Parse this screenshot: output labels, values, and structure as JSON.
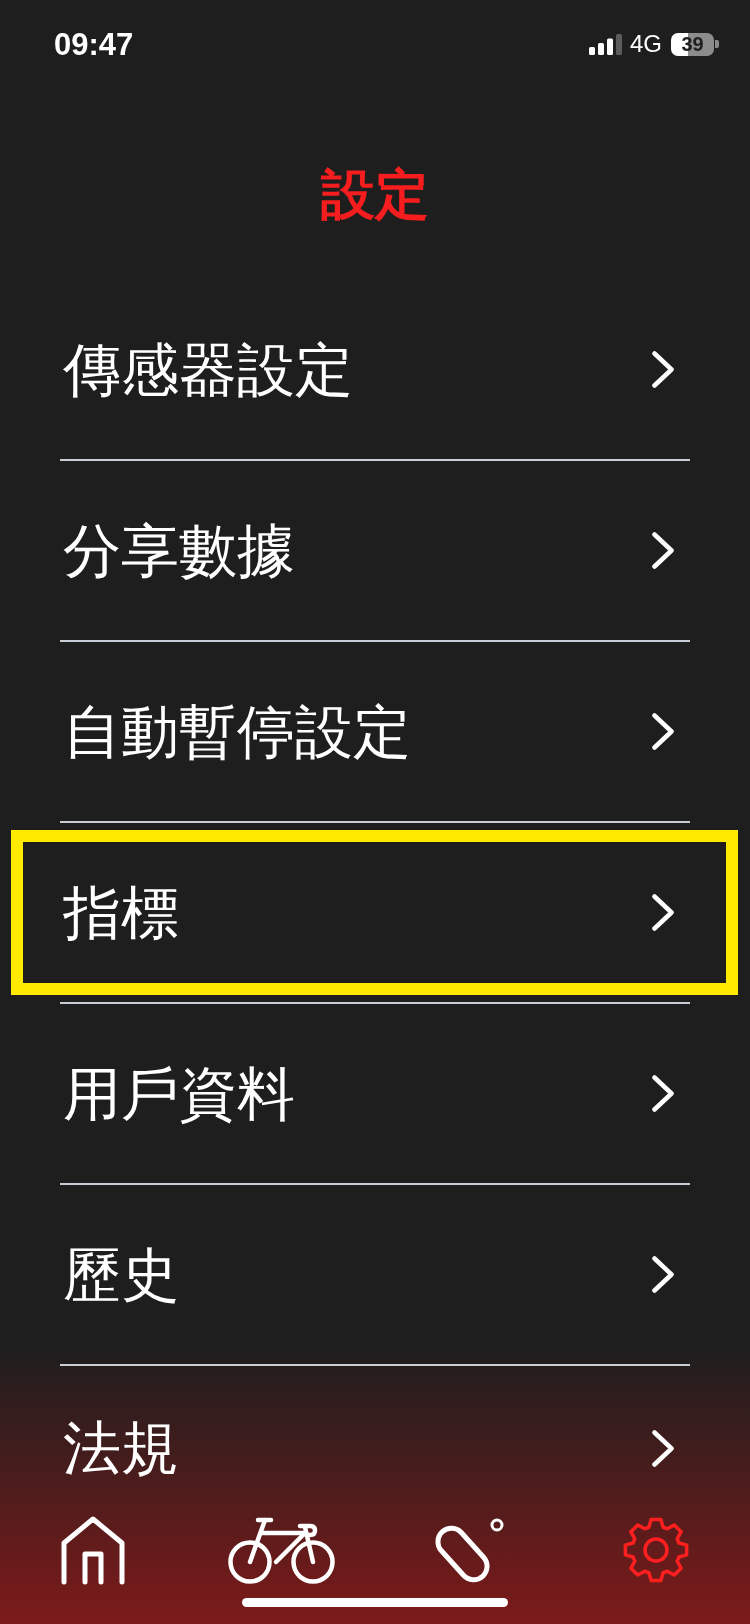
{
  "status_bar": {
    "time": "09:47",
    "network": "4G",
    "battery": "39"
  },
  "title": "設定",
  "menu": {
    "items": [
      {
        "label": "傳感器設定",
        "highlighted": false
      },
      {
        "label": "分享數據",
        "highlighted": false
      },
      {
        "label": "自動暫停設定",
        "highlighted": false
      },
      {
        "label": "指標",
        "highlighted": true
      },
      {
        "label": "用戶資料",
        "highlighted": false
      },
      {
        "label": "歷史",
        "highlighted": false
      },
      {
        "label": "法規",
        "highlighted": false
      }
    ]
  },
  "tab_bar": {
    "tabs": [
      {
        "kind": "home",
        "selected": false
      },
      {
        "kind": "bike",
        "selected": false
      },
      {
        "kind": "device",
        "selected": false
      },
      {
        "kind": "settings",
        "selected": true
      }
    ]
  }
}
